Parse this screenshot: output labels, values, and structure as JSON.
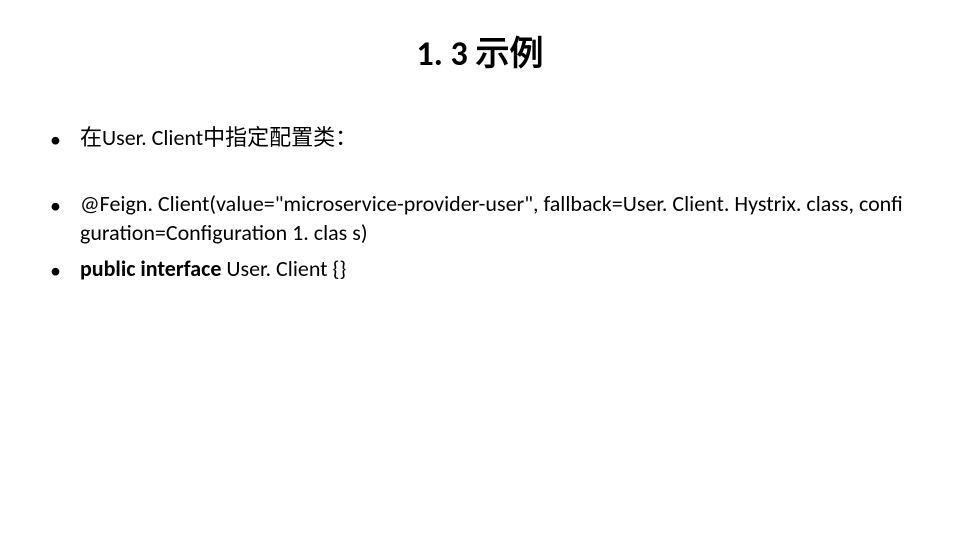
{
  "slide": {
    "title": "1. 3 示例",
    "bullets": [
      {
        "text": "在User. Client中指定配置类："
      },
      {
        "text": "@Feign. Client(value=\"microservice-provider-user\", fallback=User. Client. Hystrix. class, configuration=Configuration 1. clas s)"
      },
      {
        "prefix_bold": "public interface ",
        "rest": "User. Client {}"
      }
    ]
  }
}
